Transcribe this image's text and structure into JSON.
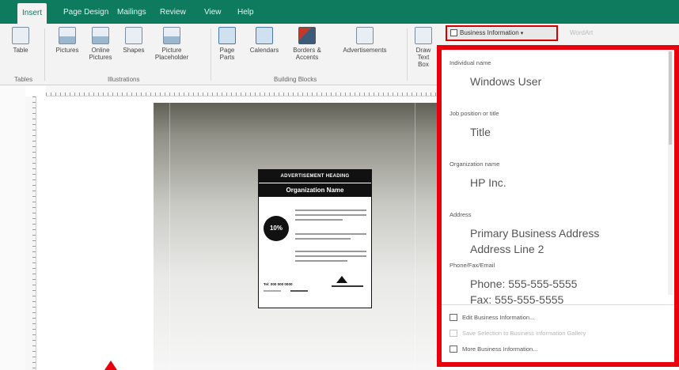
{
  "tabs": [
    {
      "label": "Insert",
      "active": true
    },
    {
      "label": "Page Design"
    },
    {
      "label": "Mailings"
    },
    {
      "label": "Review"
    },
    {
      "label": "View"
    },
    {
      "label": "Help"
    }
  ],
  "ribbon": {
    "table": {
      "label": "Table"
    },
    "pictures": {
      "label": "Pictures"
    },
    "online_pictures": {
      "label": "Online Pictures"
    },
    "shapes": {
      "label": "Shapes"
    },
    "picture_placeholder": {
      "label": "Picture Placeholder"
    },
    "page_parts": {
      "label": "Page Parts"
    },
    "calendars": {
      "label": "Calendars"
    },
    "borders_accents": {
      "label": "Borders & Accents"
    },
    "advertisements": {
      "label": "Advertisements"
    },
    "draw_text_box": {
      "label": "Draw Text Box"
    },
    "groups": {
      "tables": "Tables",
      "illustrations": "Illustrations",
      "building_blocks": "Building Blocks"
    },
    "business_information_button": "Business Information",
    "ghost_button": "WordArt"
  },
  "advertisement": {
    "heading": "ADVERTISEMENT HEADING",
    "organization": "Organization Name",
    "offer": "10% OFF",
    "phone": "Tel: 000 000 0000"
  },
  "dropdown": {
    "fields": [
      {
        "label": "Individual name",
        "value": "Windows User"
      },
      {
        "label": "Job position or title",
        "value": "Title"
      },
      {
        "label": "Organization name",
        "value": "HP Inc."
      },
      {
        "label": "Address",
        "value": "Primary Business Address",
        "value2": "Address Line 2"
      },
      {
        "label": "Phone/Fax/Email",
        "value": "Phone: 555-555-5555",
        "value2": "Fax: 555-555-5555"
      }
    ],
    "menu": [
      {
        "label": "Edit Business Information...",
        "enabled": true
      },
      {
        "label": "Save Selection to Business Information Gallery",
        "enabled": false
      },
      {
        "label": "More Business Information...",
        "enabled": true
      }
    ]
  },
  "colors": {
    "accent_green": "#0e7a5e",
    "highlight_red": "#e8000d"
  }
}
